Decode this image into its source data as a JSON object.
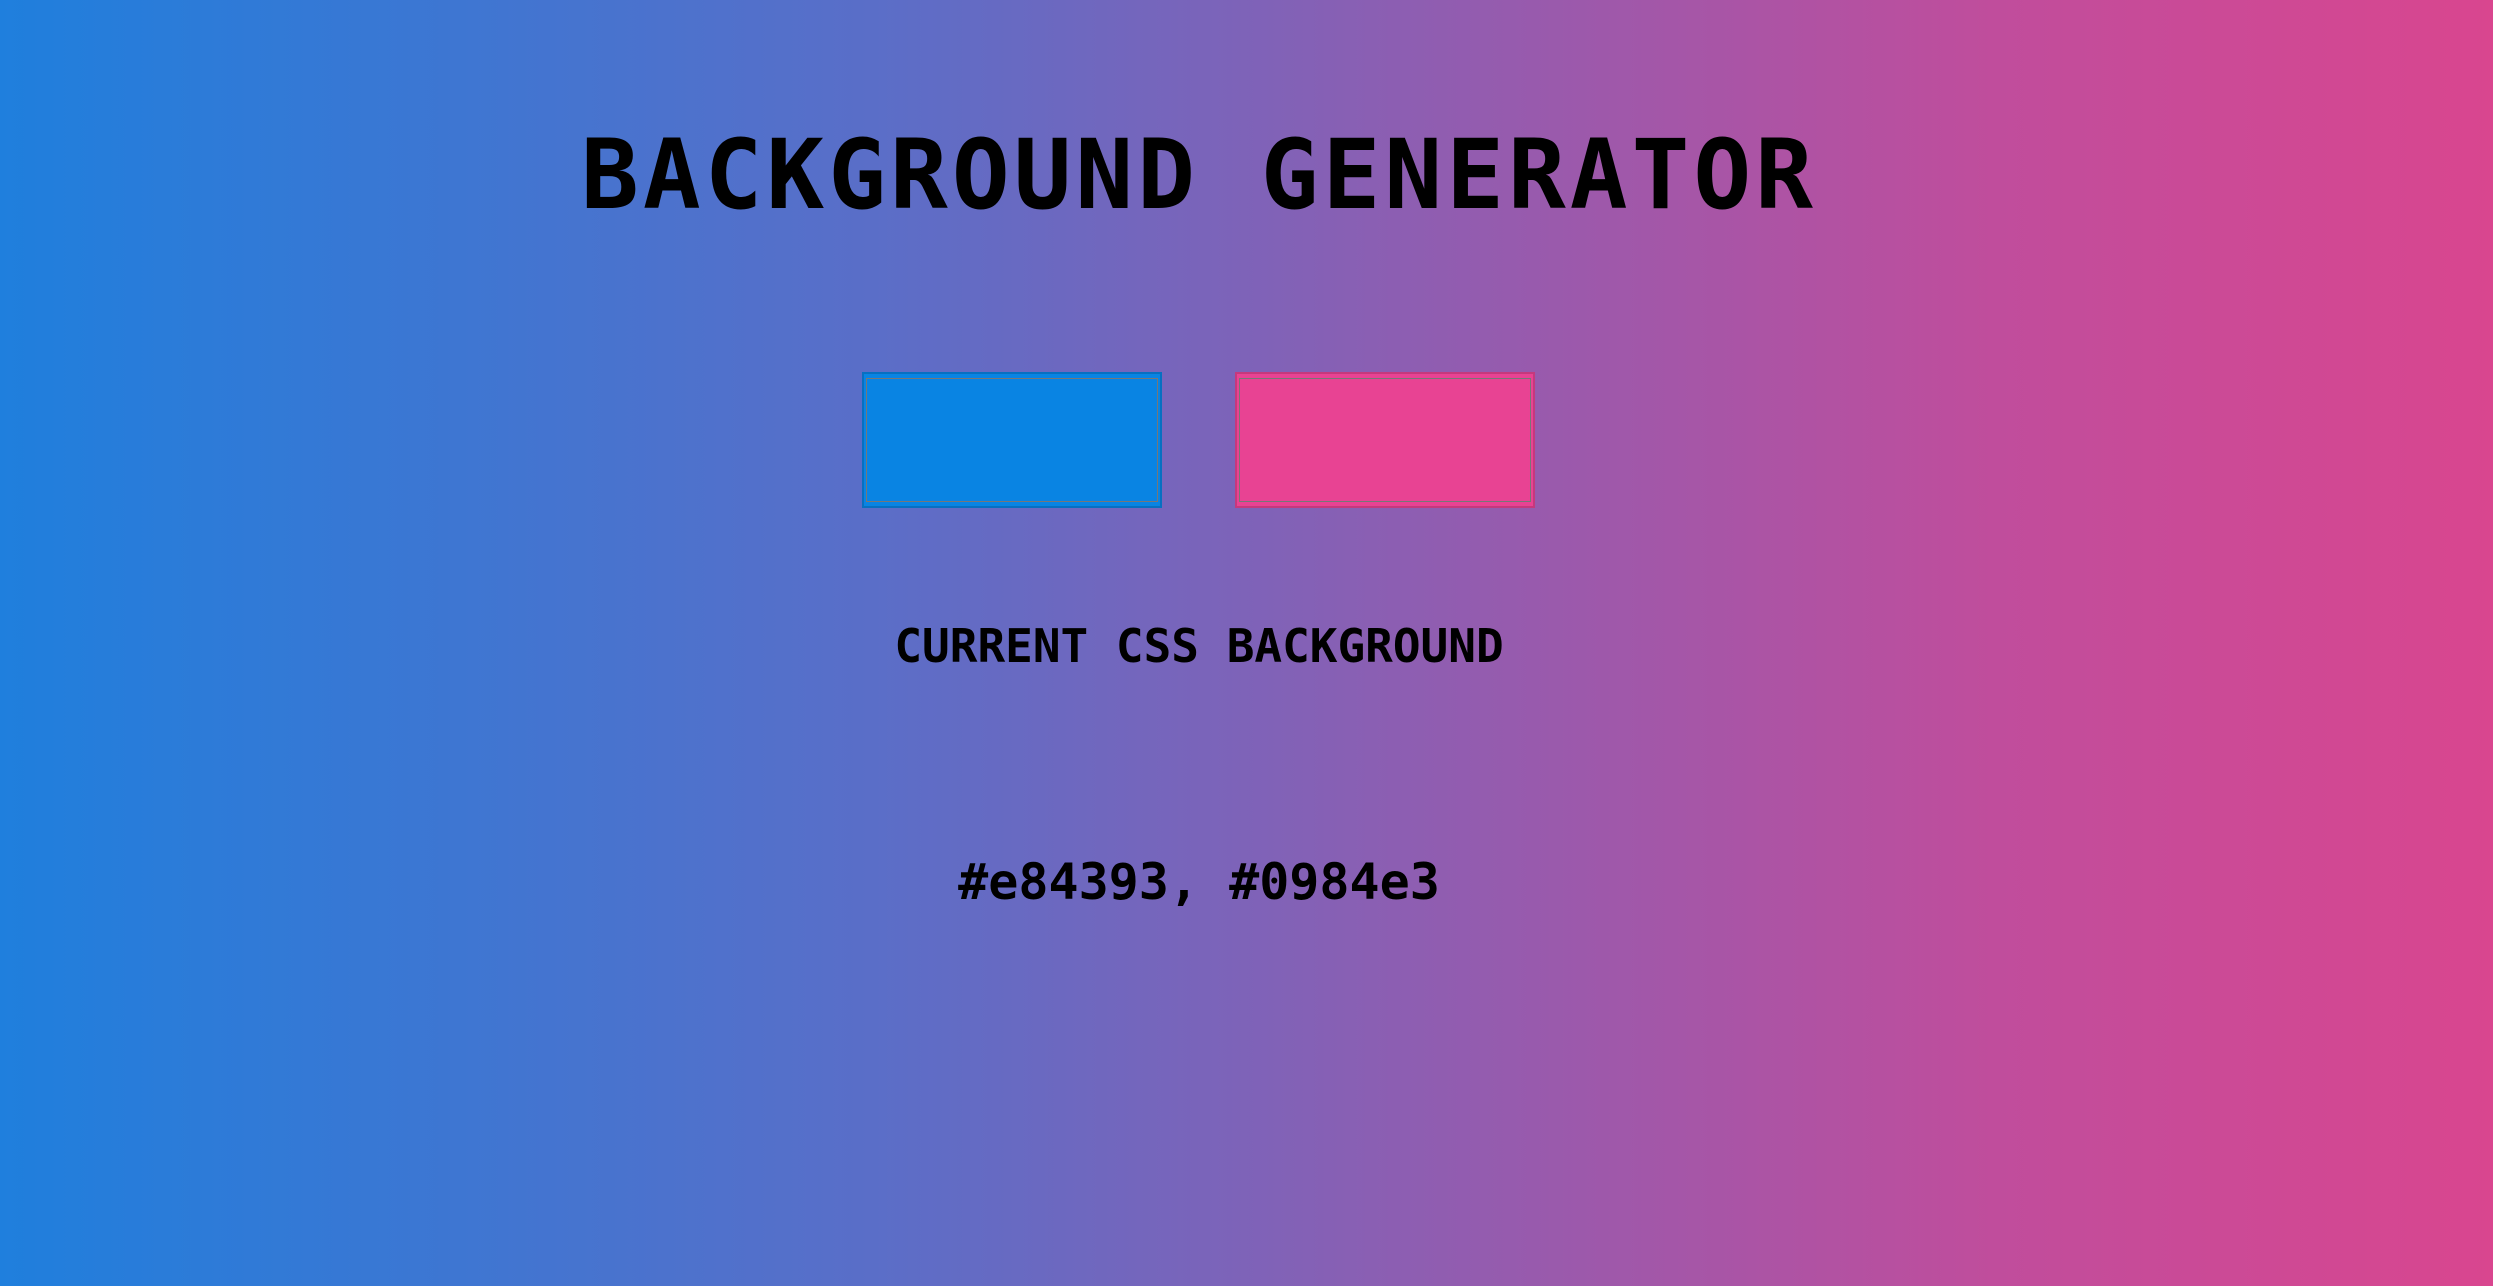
{
  "app": {
    "title": "BACKGROUND GENERATOR"
  },
  "colors": {
    "color1": "#0984e3",
    "color2": "#e84393",
    "gradient_left": "#1f7fdd",
    "gradient_right": "#d9468f"
  },
  "section": {
    "subtitle": "CURRENT CSS BACKGROUND",
    "css_value": "#e84393, #0984e3"
  }
}
